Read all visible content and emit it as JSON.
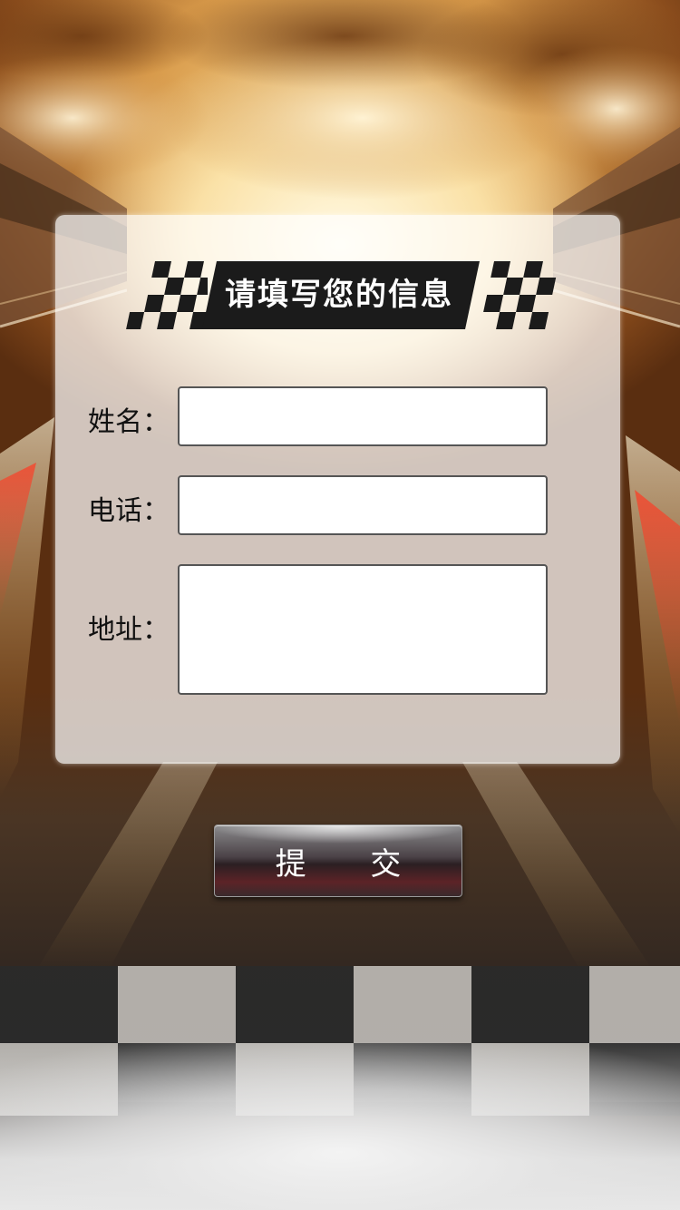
{
  "form": {
    "title": "请填写您的信息",
    "fields": [
      {
        "label": "姓名：",
        "value": ""
      },
      {
        "label": "电话：",
        "value": ""
      },
      {
        "label": "地址：",
        "value": ""
      }
    ],
    "submit_label": "提 交"
  },
  "theme": {
    "banner_color": "#1b1b1b",
    "accent_gold": "#f7d48c",
    "card_color": "rgba(255,255,255,0.72)"
  },
  "icons": {
    "banner_flags": "checkered-flag-icon"
  }
}
